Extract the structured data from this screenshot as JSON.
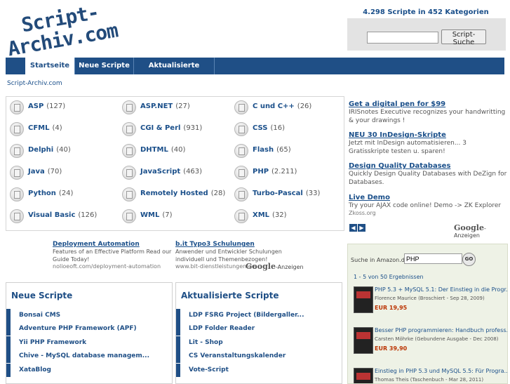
{
  "logo": {
    "line1": "Script-",
    "line2": "Archiv.com"
  },
  "stats": "4.298 Scripte in 452 Kategorien",
  "search": {
    "value": "",
    "button": "Script-Suche"
  },
  "nav": [
    {
      "label": "Startseite",
      "active": true
    },
    {
      "label": "Neue Scripte",
      "active": false
    },
    {
      "label": "Aktualisierte Scripte",
      "active": false
    }
  ],
  "breadcrumb": "Script-Archiv.com",
  "categories": [
    {
      "name": "ASP",
      "count": "(127)"
    },
    {
      "name": "ASP.NET",
      "count": "(27)"
    },
    {
      "name": "C und C++",
      "count": "(26)"
    },
    {
      "name": "CFML",
      "count": "(4)"
    },
    {
      "name": "CGI & Perl",
      "count": "(931)"
    },
    {
      "name": "CSS",
      "count": "(16)"
    },
    {
      "name": "Delphi",
      "count": "(40)"
    },
    {
      "name": "DHTML",
      "count": "(40)"
    },
    {
      "name": "Flash",
      "count": "(65)"
    },
    {
      "name": "Java",
      "count": "(70)"
    },
    {
      "name": "JavaScript",
      "count": "(463)"
    },
    {
      "name": "PHP",
      "count": "(2.211)"
    },
    {
      "name": "Python",
      "count": "(24)"
    },
    {
      "name": "Remotely Hosted",
      "count": "(28)"
    },
    {
      "name": "Turbo-Pascal",
      "count": "(33)"
    },
    {
      "name": "Visual Basic",
      "count": "(126)"
    },
    {
      "name": "WML",
      "count": "(7)"
    },
    {
      "name": "XML",
      "count": "(32)"
    }
  ],
  "right_ads": [
    {
      "title": "Get a digital pen for $99",
      "desc": "IRISnotes Executive recognizes your handwritting & your drawings !"
    },
    {
      "title": "NEU 30 InDesign-Skripte",
      "desc": "Jetzt mit InDesign automatisieren... 3 Gratisskripte testen u. sparen!"
    },
    {
      "title": "Design Quality Databases",
      "desc": "Quickly Design Quality Databases with DeZign for Databases."
    },
    {
      "title": "Live Demo",
      "desc": "Try your AJAX code online! Demo -> ZK Explorer",
      "url": "Zkoss.org"
    }
  ],
  "google_ads_label": {
    "brand": "Google",
    "suffix": "-Anzeigen"
  },
  "mid_ads": [
    {
      "title": "Deployment Automation",
      "desc": "Features of an Effective Platform Read our Guide Today!",
      "url": "nolioeoft.com/deployment-automation"
    },
    {
      "title": "b.it Typo3 Schulungen",
      "desc": "Anwender und Entwickler Schulungen individuell und Themenbezogen!",
      "url": "www.bit-dienstleistungen.de"
    }
  ],
  "amazon": {
    "label": "Suche in Amazon.de",
    "value": "PHP",
    "go": "GO",
    "count": "1 - 5 von 50 Ergebnissen",
    "items": [
      {
        "title": "PHP 5.3 + MySQL 5.1: Der Einstieg in die Progr...",
        "author": "Florence Maurice (Broschiert - Sep 28, 2009)",
        "price": "EUR 19,95"
      },
      {
        "title": "Besser PHP programmieren: Handbuch profess...",
        "author": "Carsten Möhrke (Gebundene Ausgabe - Dec 2008)",
        "price": "EUR 39,90"
      },
      {
        "title": "Einstieg in PHP 5.3 und MySQL 5.5: Für Progra...",
        "author": "Thomas Theis (Taschenbuch - Mar 28, 2011)",
        "price": ""
      }
    ]
  },
  "neue": {
    "title": "Neue Scripte",
    "items": [
      "Bonsai CMS",
      "Adventure PHP Framework (APF)",
      "Yii PHP Framework",
      "Chive - MySQL database managem...",
      "XataBlog"
    ]
  },
  "aktualisierte": {
    "title": "Aktualisierte Scripte",
    "items": [
      "LDP FSRG Project (Bildergaller...",
      "LDP Folder Reader",
      "Lit - Shop",
      "CS Veranstaltungskalender",
      "Vote-Script"
    ]
  },
  "colors": {
    "brand": "#1f4f86",
    "link": "#1a4f8a",
    "price": "#b30000"
  }
}
